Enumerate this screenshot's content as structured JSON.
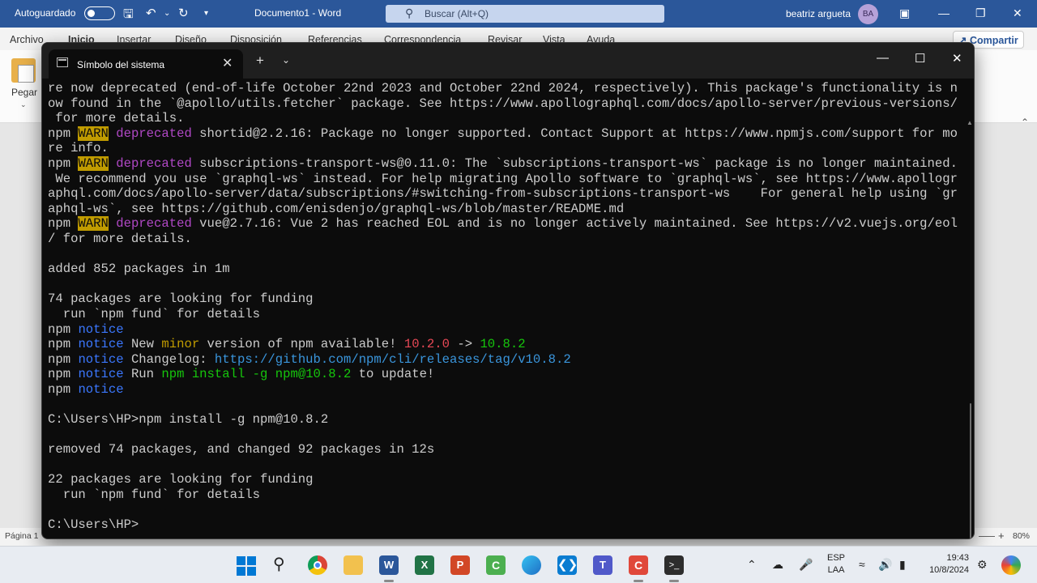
{
  "word": {
    "autosave_label": "Autoguardado",
    "doc_title": "Documento1  -  Word",
    "search_placeholder": "Buscar (Alt+Q)",
    "user_name": "beatriz argueta",
    "user_initials": "BA",
    "ribbon_tabs": [
      "Archivo",
      "Inicio",
      "Insertar",
      "Diseño",
      "Disposición",
      "Referencias",
      "Correspondencia",
      "Revisar",
      "Vista",
      "Ayuda"
    ],
    "share_label": "Compartir",
    "paste_label": "Pegar",
    "status_page": "Página 1",
    "zoom": "80%"
  },
  "terminal": {
    "tab_title": "Símbolo del sistema",
    "lines": [
      [
        {
          "t": "re now deprecated (end-of-life October 22nd 2023 and October 22nd 2024, respectively). This package's functionality is n",
          "c": ""
        }
      ],
      [
        {
          "t": "ow found in the `@apollo/utils.fetcher` package. See https://www.apollographql.com/docs/apollo-server/previous-versions/",
          "c": ""
        }
      ],
      [
        {
          "t": " for more details.",
          "c": ""
        }
      ],
      [
        {
          "t": "npm ",
          "c": ""
        },
        {
          "t": "WARN",
          "c": "warn"
        },
        {
          "t": " ",
          "c": ""
        },
        {
          "t": "deprecated",
          "c": "dep"
        },
        {
          "t": " shortid@2.2.16: Package no longer supported. Contact Support at https://www.npmjs.com/support for mo",
          "c": ""
        }
      ],
      [
        {
          "t": "re info.",
          "c": ""
        }
      ],
      [
        {
          "t": "npm ",
          "c": ""
        },
        {
          "t": "WARN",
          "c": "warn"
        },
        {
          "t": " ",
          "c": ""
        },
        {
          "t": "deprecated",
          "c": "dep"
        },
        {
          "t": " subscriptions-transport-ws@0.11.0: The `subscriptions-transport-ws` package is no longer maintained.",
          "c": ""
        }
      ],
      [
        {
          "t": " We recommend you use `graphql-ws` instead. For help migrating Apollo software to `graphql-ws`, see https://www.apollogr",
          "c": ""
        }
      ],
      [
        {
          "t": "aphql.com/docs/apollo-server/data/subscriptions/#switching-from-subscriptions-transport-ws    For general help using `gr",
          "c": ""
        }
      ],
      [
        {
          "t": "aphql-ws`, see https://github.com/enisdenjo/graphql-ws/blob/master/README.md",
          "c": ""
        }
      ],
      [
        {
          "t": "npm ",
          "c": ""
        },
        {
          "t": "WARN",
          "c": "warn"
        },
        {
          "t": " ",
          "c": ""
        },
        {
          "t": "deprecated",
          "c": "dep"
        },
        {
          "t": " vue@2.7.16: Vue 2 has reached EOL and is no longer actively maintained. See https://v2.vuejs.org/eol",
          "c": ""
        }
      ],
      [
        {
          "t": "/ for more details.",
          "c": ""
        }
      ],
      [
        {
          "t": "",
          "c": ""
        }
      ],
      [
        {
          "t": "added 852 packages in 1m",
          "c": ""
        }
      ],
      [
        {
          "t": "",
          "c": ""
        }
      ],
      [
        {
          "t": "74 packages are looking for funding",
          "c": ""
        }
      ],
      [
        {
          "t": "  run `npm fund` for details",
          "c": ""
        }
      ],
      [
        {
          "t": "npm ",
          "c": ""
        },
        {
          "t": "notice",
          "c": "notice"
        }
      ],
      [
        {
          "t": "npm ",
          "c": ""
        },
        {
          "t": "notice",
          "c": "notice"
        },
        {
          "t": " New ",
          "c": ""
        },
        {
          "t": "minor",
          "c": "minor"
        },
        {
          "t": " version of npm available! ",
          "c": ""
        },
        {
          "t": "10.2.0",
          "c": "red"
        },
        {
          "t": " -> ",
          "c": ""
        },
        {
          "t": "10.8.2",
          "c": "green"
        }
      ],
      [
        {
          "t": "npm ",
          "c": ""
        },
        {
          "t": "notice",
          "c": "notice"
        },
        {
          "t": " Changelog: ",
          "c": ""
        },
        {
          "t": "https://github.com/npm/cli/releases/tag/v10.8.2",
          "c": "cyan"
        }
      ],
      [
        {
          "t": "npm ",
          "c": ""
        },
        {
          "t": "notice",
          "c": "notice"
        },
        {
          "t": " Run ",
          "c": ""
        },
        {
          "t": "npm install -g npm@10.8.2",
          "c": "green"
        },
        {
          "t": " to update!",
          "c": ""
        }
      ],
      [
        {
          "t": "npm ",
          "c": ""
        },
        {
          "t": "notice",
          "c": "notice"
        }
      ],
      [
        {
          "t": "",
          "c": ""
        }
      ],
      [
        {
          "t": "C:\\Users\\HP>npm install -g npm@10.8.2",
          "c": ""
        }
      ],
      [
        {
          "t": "",
          "c": ""
        }
      ],
      [
        {
          "t": "removed 74 packages, and changed 92 packages in 12s",
          "c": ""
        }
      ],
      [
        {
          "t": "",
          "c": ""
        }
      ],
      [
        {
          "t": "22 packages are looking for funding",
          "c": ""
        }
      ],
      [
        {
          "t": "  run `npm fund` for details",
          "c": ""
        }
      ],
      [
        {
          "t": "",
          "c": ""
        }
      ],
      [
        {
          "t": "C:\\Users\\HP>",
          "c": ""
        }
      ]
    ]
  },
  "taskbar": {
    "lang_top": "ESP",
    "lang_bottom": "LAA",
    "time": "19:43",
    "date": "10/8/2024"
  },
  "icons": {
    "start": "windows-start-icon",
    "search": "search-icon",
    "chrome": "chrome-icon",
    "explorer": "folder-icon",
    "word": "word-icon",
    "excel": "excel-icon",
    "powerpoint": "powerpoint-icon",
    "camtasia": "camtasia-icon",
    "edge": "edge-icon",
    "vscode": "vscode-icon",
    "teams": "teams-icon",
    "recorder": "recorder-icon",
    "terminal": "terminal-icon"
  }
}
